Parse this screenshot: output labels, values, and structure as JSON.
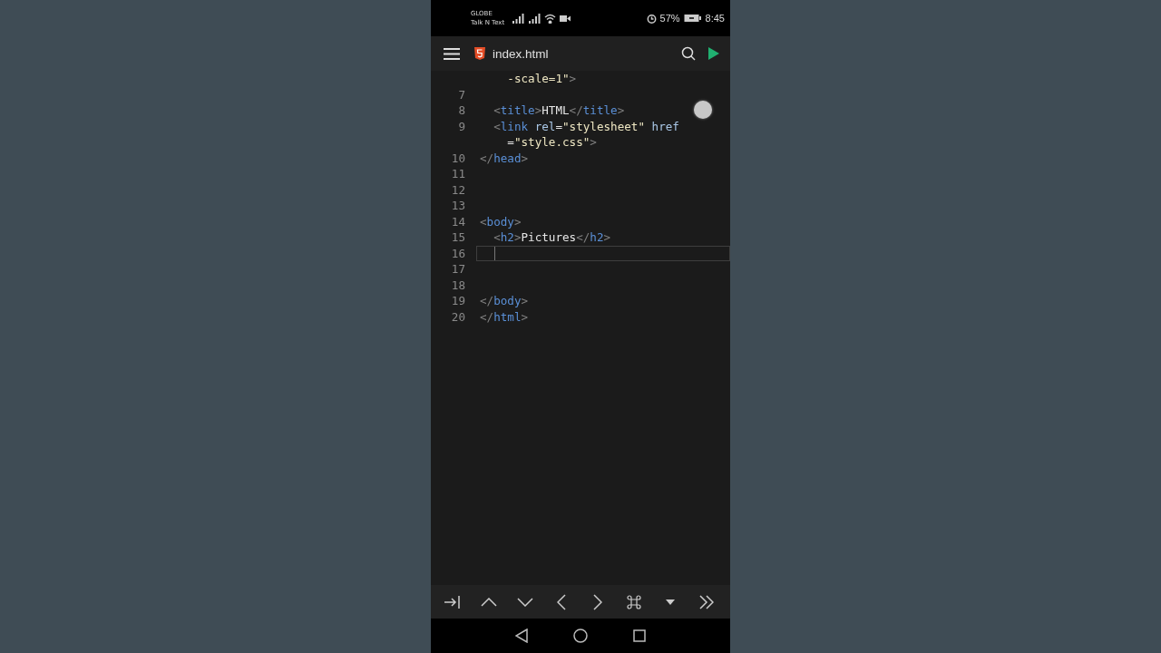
{
  "status_bar": {
    "carrier": [
      "GLOBE",
      "Talk N Text"
    ],
    "battery": "57%",
    "time": "8:45"
  },
  "toolbar": {
    "file_name": "index.html"
  },
  "editor": {
    "rows": [
      {
        "current": false,
        "tokens": [
          {
            "kind": "str",
            "text": "    -scale=1\""
          },
          {
            "kind": "punct",
            "text": ">"
          }
        ]
      },
      {
        "number": "7",
        "current": false,
        "tokens": []
      },
      {
        "number": "8",
        "current": false,
        "tokens": [
          {
            "kind": "punct",
            "text": "  <"
          },
          {
            "kind": "tag",
            "text": "title"
          },
          {
            "kind": "punct",
            "text": ">"
          },
          {
            "kind": "text",
            "text": "HTML"
          },
          {
            "kind": "punct",
            "text": "</"
          },
          {
            "kind": "tag",
            "text": "title"
          },
          {
            "kind": "punct",
            "text": ">"
          }
        ]
      },
      {
        "number": "9",
        "current": false,
        "tokens": [
          {
            "kind": "punct",
            "text": "  <"
          },
          {
            "kind": "tag",
            "text": "link"
          },
          {
            "kind": "attr",
            "text": " rel"
          },
          {
            "kind": "text",
            "text": "="
          },
          {
            "kind": "str",
            "text": "\"stylesheet\""
          },
          {
            "kind": "attr",
            "text": " href"
          }
        ]
      },
      {
        "current": false,
        "tokens": [
          {
            "kind": "text",
            "text": "    ="
          },
          {
            "kind": "str",
            "text": "\"style.css\""
          },
          {
            "kind": "punct",
            "text": ">"
          }
        ]
      },
      {
        "number": "10",
        "current": false,
        "tokens": [
          {
            "kind": "punct",
            "text": "</"
          },
          {
            "kind": "tag",
            "text": "head"
          },
          {
            "kind": "punct",
            "text": ">"
          }
        ]
      },
      {
        "number": "11",
        "current": false,
        "tokens": []
      },
      {
        "number": "12",
        "current": false,
        "tokens": []
      },
      {
        "number": "13",
        "current": false,
        "tokens": []
      },
      {
        "number": "14",
        "current": false,
        "tokens": [
          {
            "kind": "punct",
            "text": "<"
          },
          {
            "kind": "tag",
            "text": "body"
          },
          {
            "kind": "punct",
            "text": ">"
          }
        ]
      },
      {
        "number": "15",
        "current": false,
        "tokens": [
          {
            "kind": "punct",
            "text": "  <"
          },
          {
            "kind": "tag",
            "text": "h2"
          },
          {
            "kind": "punct",
            "text": ">"
          },
          {
            "kind": "text",
            "text": "Pictures"
          },
          {
            "kind": "punct",
            "text": "</"
          },
          {
            "kind": "tag",
            "text": "h2"
          },
          {
            "kind": "punct",
            "text": ">"
          }
        ]
      },
      {
        "number": "16",
        "current": true,
        "tokens": []
      },
      {
        "number": "17",
        "current": false,
        "tokens": []
      },
      {
        "number": "18",
        "current": false,
        "tokens": []
      },
      {
        "number": "19",
        "current": false,
        "tokens": [
          {
            "kind": "punct",
            "text": "</"
          },
          {
            "kind": "tag",
            "text": "body"
          },
          {
            "kind": "punct",
            "text": ">"
          }
        ]
      },
      {
        "number": "20",
        "current": false,
        "tokens": [
          {
            "kind": "punct",
            "text": "</"
          },
          {
            "kind": "tag",
            "text": "html"
          },
          {
            "kind": "punct",
            "text": ">"
          }
        ]
      }
    ]
  },
  "key_bar": {
    "keys": [
      {
        "kind": "tab"
      },
      {
        "kind": "up"
      },
      {
        "kind": "down"
      },
      {
        "kind": "left"
      },
      {
        "kind": "right"
      },
      {
        "kind": "command"
      },
      {
        "kind": "menu"
      },
      {
        "kind": "more"
      }
    ]
  },
  "nav_bar": {
    "buttons": [
      {
        "kind": "back"
      },
      {
        "kind": "home"
      },
      {
        "kind": "recents"
      }
    ]
  }
}
